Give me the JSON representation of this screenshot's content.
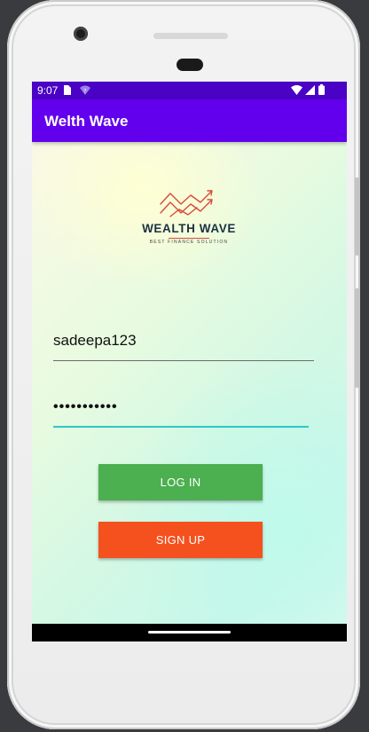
{
  "status_bar": {
    "time": "9:07",
    "icons": [
      "sim-card-icon",
      "vpn-icon",
      "wifi-icon",
      "signal-icon",
      "battery-icon"
    ]
  },
  "app_bar": {
    "title": "Welth Wave"
  },
  "logo": {
    "wordmark": "WEALTH WAVE",
    "tagline": "BEST FINANCE SOLUTION"
  },
  "form": {
    "username_value": "sadeepa123",
    "password_value": "•••••••••••"
  },
  "buttons": {
    "login_label": "LOG IN",
    "signup_label": "SIGN UP"
  },
  "colors": {
    "status_bar": "#4a03c4",
    "app_bar": "#6200ee",
    "login_button": "#4caf50",
    "signup_button": "#f4511e",
    "password_underline": "#2dc8c4",
    "logo_accent": "#d84a3a",
    "logo_text": "#1b3143"
  }
}
